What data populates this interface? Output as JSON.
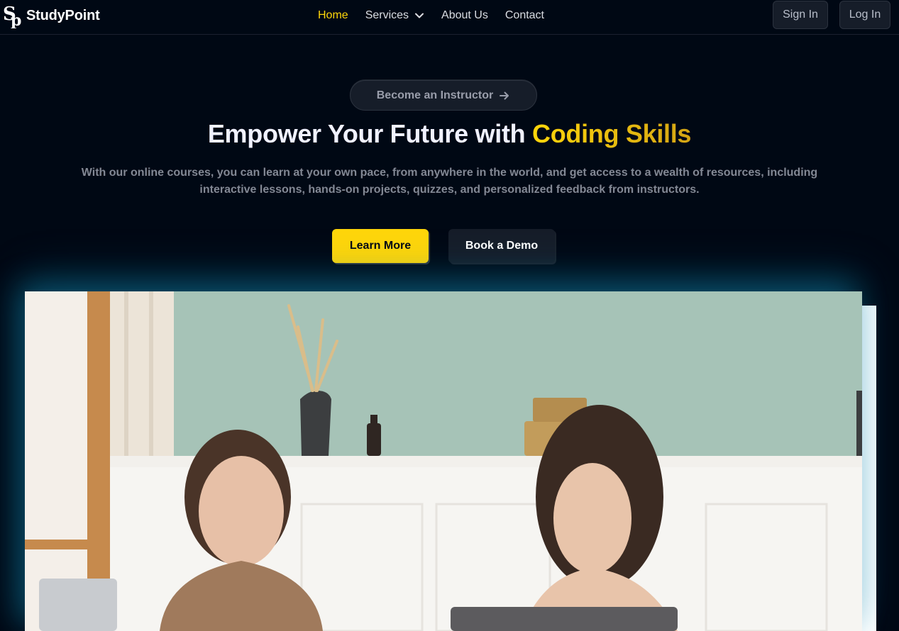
{
  "brand": {
    "name": "StudyPoint",
    "logo_icon": "sp-monogram-icon"
  },
  "nav": {
    "links": [
      {
        "label": "Home",
        "active": true
      },
      {
        "label": "Services",
        "active": false,
        "has_dropdown": true
      },
      {
        "label": "About Us",
        "active": false
      },
      {
        "label": "Contact",
        "active": false
      }
    ],
    "sign_in_label": "Sign In",
    "log_in_label": "Log In"
  },
  "hero": {
    "badge_label": "Become an Instructor",
    "badge_icon": "arrow-right-icon",
    "title_prefix": "Empower Your Future with ",
    "title_highlight": "Coding Skills",
    "subtitle": "With our online courses, you can learn at your own pace, from anywhere in the world, and get access to a wealth of resources, including interactive lessons, hands-on projects, quizzes, and personalized feedback from instructors.",
    "primary_cta": "Learn More",
    "secondary_cta": "Book a Demo"
  },
  "media": {
    "type": "video",
    "content": "two-women-studying-with-laptops"
  },
  "colors": {
    "background": "#000814",
    "accent_yellow": "#ffd60a",
    "surface": "#161d29",
    "muted_text": "#838894",
    "glow_blue": "#118ab2"
  }
}
